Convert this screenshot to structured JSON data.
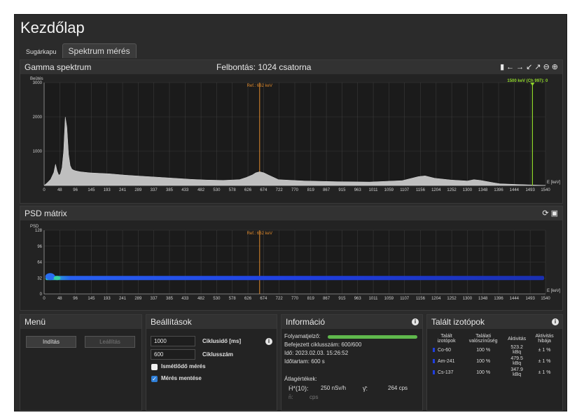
{
  "page": {
    "title": "Kezdőlap"
  },
  "tabs": [
    {
      "label": "Sugárkapu",
      "active": false
    },
    {
      "label": "Spektrum mérés",
      "active": true
    }
  ],
  "gamma": {
    "title": "Gamma spektrum",
    "resolution": "Felbontás: 1024 csatorna",
    "ylabel": "Beütés",
    "xlabel": "E [keV]",
    "ref_label": "Ref.: 662 keV",
    "cursor_label": "1500 keV (Ch 997): 0",
    "toolbar_icons": [
      "bar-chart-icon",
      "arrow-left-icon",
      "arrow-right-icon",
      "shrink-icon",
      "expand-icon",
      "zoom-out-icon",
      "zoom-in-icon"
    ]
  },
  "psd": {
    "title": "PSD mátrix",
    "ylabel": "PSD",
    "xlabel": "E [keV]",
    "ref_label": "Ref.: 662 keV",
    "toolbar_icons": [
      "refresh-icon",
      "save-icon"
    ]
  },
  "chart_data": [
    {
      "type": "area",
      "title": "Gamma spektrum",
      "xlabel": "E [keV]",
      "ylabel": "Beütés",
      "xlim": [
        0,
        1540
      ],
      "ylim": [
        0,
        3000
      ],
      "y_ticks": [
        1000,
        2000,
        3000
      ],
      "x_ticks": [
        0,
        48,
        96,
        145,
        193,
        241,
        289,
        337,
        385,
        433,
        482,
        530,
        578,
        626,
        674,
        722,
        770,
        819,
        867,
        915,
        963,
        1011,
        1059,
        1107,
        1156,
        1204,
        1252,
        1300,
        1348,
        1396,
        1444,
        1493,
        1540
      ],
      "grid": true,
      "ref_line_keV": 662,
      "cursor_keV": 1500,
      "series": [
        {
          "x": [
            0,
            10,
            20,
            30,
            35,
            40,
            45,
            50,
            55,
            60,
            65,
            70,
            75,
            80,
            85,
            90,
            95,
            100,
            110,
            120,
            140,
            160,
            200,
            250,
            300,
            350,
            400,
            450,
            500,
            550,
            600,
            620,
            640,
            650,
            662,
            675,
            690,
            720,
            800,
            900,
            1000,
            1100,
            1150,
            1170,
            1200,
            1250,
            1300,
            1320,
            1340,
            1380,
            1400,
            1450,
            1500,
            1540
          ],
          "y": [
            0,
            80,
            180,
            380,
            620,
            420,
            300,
            330,
            520,
            1000,
            2000,
            1700,
            900,
            580,
            480,
            450,
            430,
            420,
            400,
            390,
            370,
            360,
            340,
            300,
            270,
            240,
            210,
            180,
            160,
            150,
            170,
            230,
            310,
            370,
            400,
            370,
            300,
            170,
            130,
            110,
            100,
            140,
            260,
            280,
            210,
            160,
            130,
            170,
            150,
            80,
            50,
            30,
            15,
            5
          ]
        }
      ]
    },
    {
      "type": "heatmap",
      "title": "PSD mátrix",
      "xlabel": "E [keV]",
      "ylabel": "PSD",
      "xlim": [
        0,
        1540
      ],
      "ylim": [
        0,
        128
      ],
      "y_ticks": [
        0,
        32,
        64,
        96,
        128
      ],
      "x_ticks": [
        0,
        48,
        96,
        145,
        193,
        241,
        289,
        337,
        385,
        433,
        482,
        530,
        578,
        626,
        674,
        722,
        770,
        819,
        867,
        915,
        963,
        1011,
        1059,
        1107,
        1156,
        1204,
        1252,
        1300,
        1348,
        1396,
        1444,
        1493,
        1540
      ],
      "grid": true,
      "ref_line_keV": 662,
      "band_psd": 32
    }
  ],
  "menu": {
    "title": "Menü",
    "start": "Indítás",
    "stop": "Leállítás"
  },
  "settings": {
    "title": "Beállítások",
    "cycle_time_value": "1000",
    "cycle_time_label": "Ciklusidő [ms]",
    "cycle_count_value": "600",
    "cycle_count_label": "Ciklusszám",
    "repeat_label": "Ismétlődő mérés",
    "repeat_checked": false,
    "save_label": "Mérés mentése",
    "save_checked": true
  },
  "info": {
    "title": "Információ",
    "progress_label": "Folyamatjelző:",
    "progress_fraction": 1.0,
    "completed": "Befejezett ciklusszám: 600/600",
    "time": "Idő:  2023.02.03. 15:26:52",
    "duration": "Időtartam:  600 s",
    "averages_label": "Átlagértékek:",
    "dose_symbol": "Ḣ*(10):",
    "dose_value": "250 nSv/h",
    "gamma_symbol": "γ̄:",
    "gamma_value": "264 cps",
    "neutron_symbol": "n̄:",
    "neutron_value": "cps"
  },
  "isotopes": {
    "title": "Talált izotópok",
    "headers": [
      "Talált izotópok",
      "Találati valószínűség",
      "Aktivitás",
      "Aktivitás hibája"
    ],
    "rows": [
      {
        "name": "Co-60",
        "prob": "100 %",
        "activity": "523.2 kBq",
        "err": "± 1 %"
      },
      {
        "name": "Am-241",
        "prob": "100 %",
        "activity": "479.5 kBq",
        "err": "± 1 %"
      },
      {
        "name": "Cs-137",
        "prob": "100 %",
        "activity": "347.9 kBq",
        "err": "± 1 %"
      }
    ]
  },
  "colors": {
    "spectrum_fill": "#bfbfbf",
    "ref_line": "#e08a2c",
    "cursor_line": "#8fd62a",
    "psd_band": "#1f3fe0",
    "progress": "#5fb84c",
    "checkbox_checked": "#2f7fd8"
  }
}
